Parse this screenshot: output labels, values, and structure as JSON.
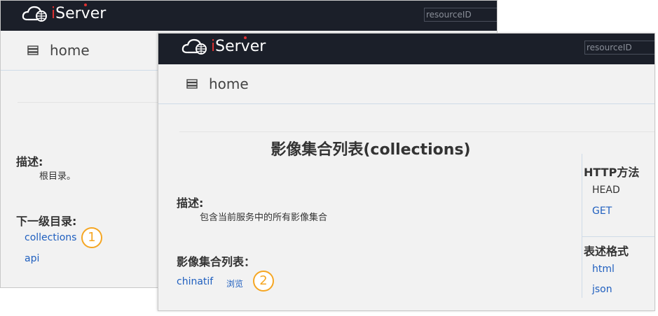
{
  "back_window": {
    "logo_text": "iServer",
    "search_placeholder": "resourceID",
    "home_label": "home",
    "description_heading": "描述:",
    "description_text": "根目录。",
    "children_heading": "下一级目录:",
    "links": [
      "collections",
      "api"
    ],
    "badge": "1"
  },
  "front_window": {
    "logo_text": "iServer",
    "search_placeholder": "resourceID",
    "home_label": "home",
    "page_title": "影像集合列表(collections)",
    "description_heading": "描述:",
    "description_text": "包含当前服务中的所有影像集合",
    "list_heading": "影像集合列表：",
    "list_item": "chinatif",
    "browse_link": "浏览",
    "badge": "2",
    "http_methods_heading": "HTTP方法",
    "http_methods": [
      "HEAD",
      "GET"
    ],
    "formats_heading": "表述格式",
    "formats": [
      "html",
      "json"
    ]
  },
  "colors": {
    "topbar": "#1b1f29",
    "link": "#1f5fbf",
    "badge": "#f5a623",
    "logo_accent": "#e03232"
  },
  "icons": [
    "cloud-globe-logo-icon",
    "server-list-icon"
  ]
}
